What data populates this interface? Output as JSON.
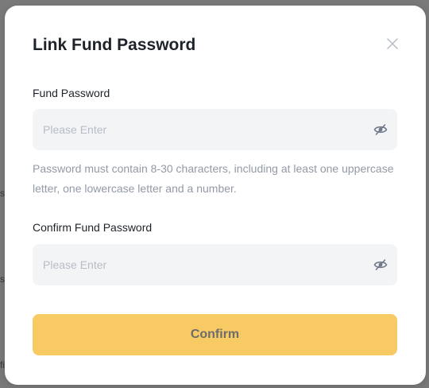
{
  "dialog": {
    "title": "Link Fund Password",
    "close_icon": "close-icon"
  },
  "fund_password": {
    "label": "Fund Password",
    "placeholder": "Please Enter",
    "icon": "eye-off-icon"
  },
  "hint": "Password must contain 8-30 characters, including at least one uppercase letter, one lowercase letter and a number.",
  "confirm_password": {
    "label": "Confirm Fund Password",
    "placeholder": "Please Enter",
    "icon": "eye-off-icon"
  },
  "confirm_button": {
    "label": "Confirm"
  },
  "colors": {
    "accent": "#f8ca64",
    "input_bg": "#f3f4f6",
    "hint_text": "#929aa5"
  }
}
